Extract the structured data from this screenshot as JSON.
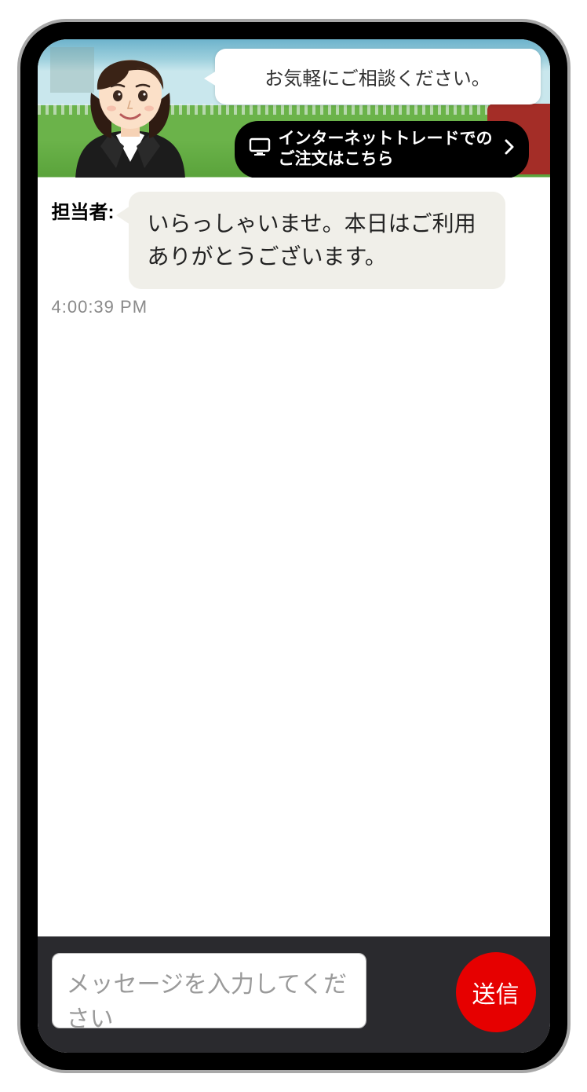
{
  "banner": {
    "speech_text": "お気軽にご相談ください。",
    "cta_line1": "インターネットトレードでの",
    "cta_line2": "ご注文はこちら"
  },
  "chat": {
    "sender_label": "担当者:",
    "messages": [
      {
        "text": "いらっしゃいませ。本日はご利用ありがとうございます。"
      }
    ],
    "timestamp": "4:00:39 PM"
  },
  "composer": {
    "placeholder": "メッセージを入力してください",
    "send_label": "送信"
  }
}
